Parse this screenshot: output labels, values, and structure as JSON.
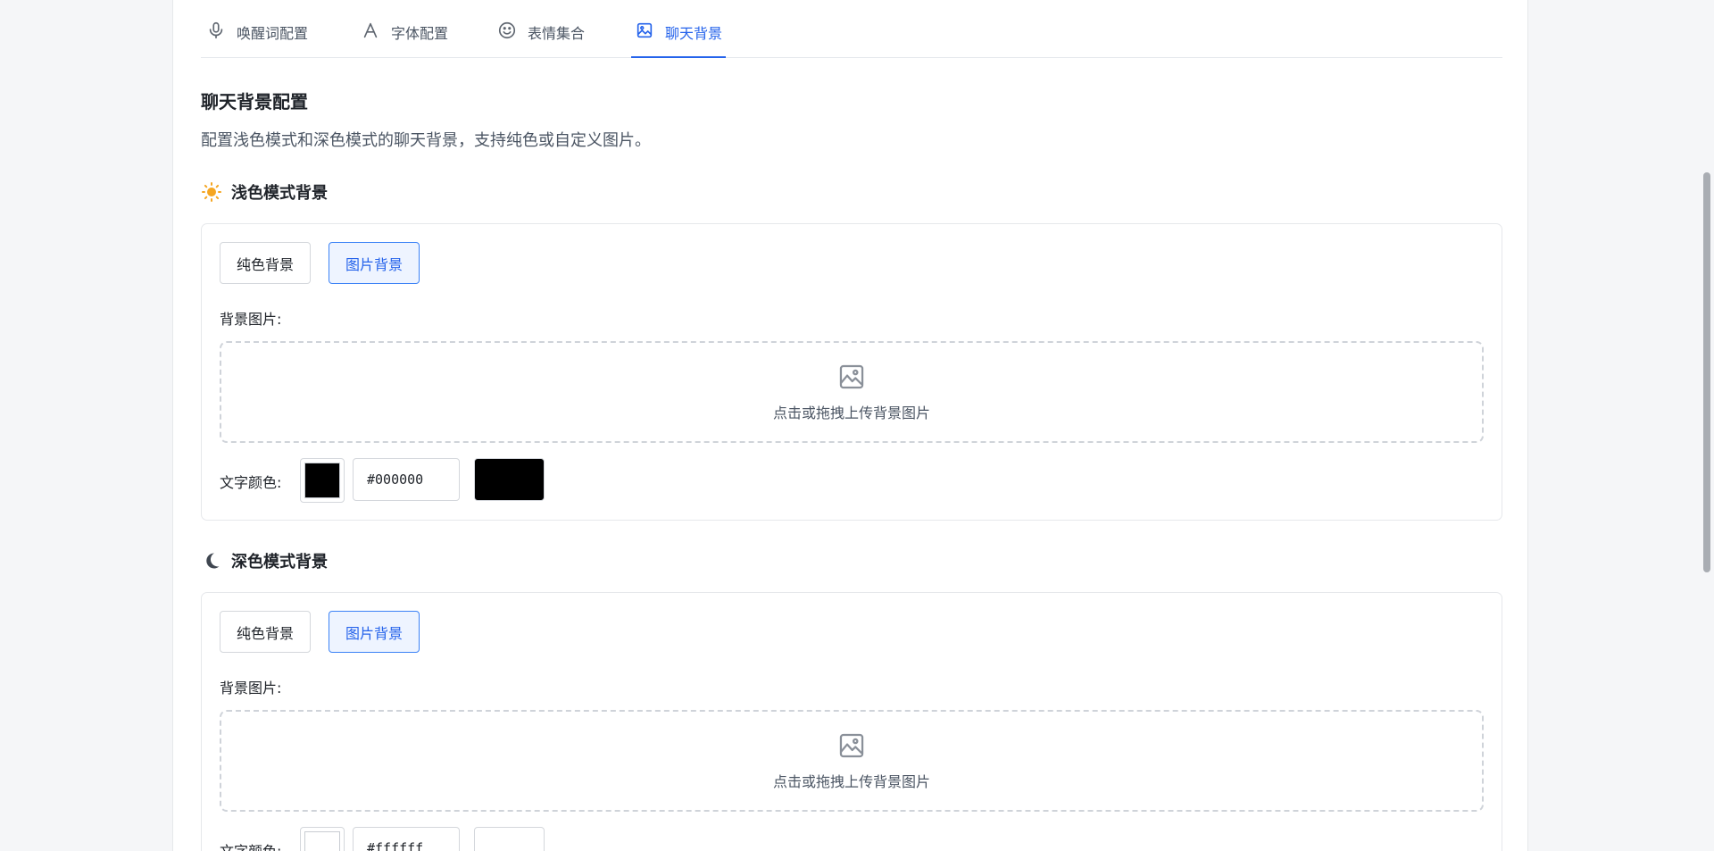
{
  "tabs": [
    {
      "label": "唤醒词配置",
      "icon": "microphone-icon"
    },
    {
      "label": "字体配置",
      "icon": "font-icon"
    },
    {
      "label": "表情集合",
      "icon": "smiley-icon"
    },
    {
      "label": "聊天背景",
      "icon": "image-icon",
      "active": true
    }
  ],
  "page": {
    "title": "聊天背景配置",
    "description": "配置浅色模式和深色模式的聊天背景，支持纯色或自定义图片。"
  },
  "light": {
    "heading": "浅色模式背景",
    "icon": "sun-icon",
    "solid_label": "纯色背景",
    "image_label": "图片背景",
    "selected": "image",
    "bg_image_label": "背景图片:",
    "upload_text": "点击或拖拽上传背景图片",
    "text_color_label": "文字颜色:",
    "text_color": "#000000"
  },
  "dark": {
    "heading": "深色模式背景",
    "icon": "moon-icon",
    "solid_label": "纯色背景",
    "image_label": "图片背景",
    "selected": "image",
    "bg_image_label": "背景图片:",
    "upload_text": "点击或拖拽上传背景图片",
    "text_color_label": "文字颜色:",
    "text_color": "#ffffff"
  },
  "colors": {
    "accent": "#2563eb",
    "sun": "#f5a623",
    "moon": "#3f4650"
  }
}
